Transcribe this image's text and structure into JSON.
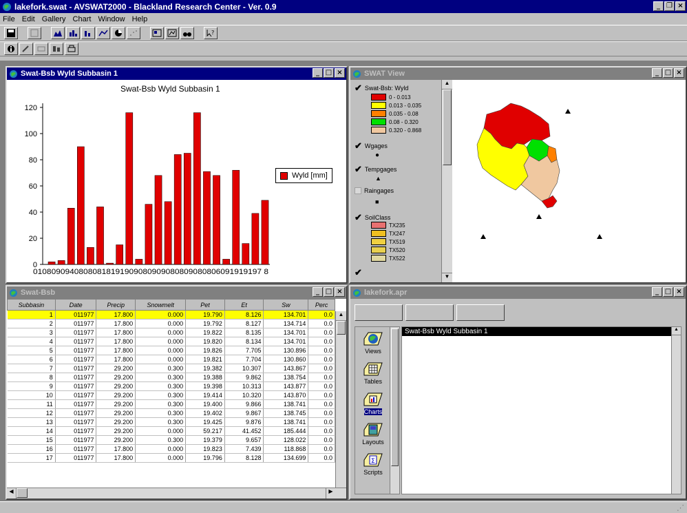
{
  "app": {
    "title": "lakefork.swat - AVSWAT2000 - Blackland Research Center - Ver. 0.9",
    "menus": [
      "File",
      "Edit",
      "Gallery",
      "Chart",
      "Window",
      "Help"
    ]
  },
  "chart_window": {
    "title": "Swat-Bsb Wyld Subbasin 1",
    "chart_data": {
      "type": "bar",
      "title": "Swat-Bsb Wyld Subbasin 1",
      "xtick_text": "01080909408080818191909080909080809080806091919197 8",
      "series": [
        {
          "name": "Wyld  [mm]",
          "color": "#e00000",
          "values": [
            2,
            3,
            43,
            90,
            13,
            44,
            1,
            15,
            116,
            4,
            46,
            68,
            48,
            84,
            85,
            116,
            71,
            68,
            4,
            72,
            16,
            39,
            49
          ]
        }
      ],
      "yticks": [
        "0",
        "20",
        "40",
        "60",
        "80",
        "100",
        "120"
      ],
      "ylim": [
        0,
        120
      ],
      "legend_position": "right",
      "grid": false
    }
  },
  "view_window": {
    "title": "SWAT View",
    "toc": {
      "theme1": "Swat-Bsb: Wyld",
      "classes": [
        {
          "label": "0 - 0.013",
          "color": "#e00000"
        },
        {
          "label": "0.013 - 0.035",
          "color": "#ffff00"
        },
        {
          "label": "0.035 - 0.08",
          "color": "#ff8000"
        },
        {
          "label": "0.08 - 0.320",
          "color": "#00e000"
        },
        {
          "label": "0.320 - 0.868",
          "color": "#f0c8a0"
        }
      ],
      "theme2": "Wgages",
      "theme3": "Tempgages",
      "theme4": "Raingages",
      "theme5": "SoilClass",
      "soil_classes": [
        {
          "label": "TX235",
          "color": "#e87070"
        },
        {
          "label": "TX247",
          "color": "#f0c020"
        },
        {
          "label": "TX519",
          "color": "#f0d040"
        },
        {
          "label": "TX520",
          "color": "#e8d050"
        },
        {
          "label": "TX522",
          "color": "#e0d8a0"
        }
      ]
    }
  },
  "table_window": {
    "title": "Swat-Bsb",
    "columns": [
      "Subbasin",
      "Date",
      "Precip",
      "Snowmelt",
      "Pet",
      "Et",
      "Sw",
      "Perc"
    ],
    "rows": [
      [
        "1",
        "011977",
        "17.800",
        "0.000",
        "19.790",
        "8.126",
        "134.701",
        "0.0"
      ],
      [
        "2",
        "011977",
        "17.800",
        "0.000",
        "19.792",
        "8.127",
        "134.714",
        "0.0"
      ],
      [
        "3",
        "011977",
        "17.800",
        "0.000",
        "19.822",
        "8.135",
        "134.701",
        "0.0"
      ],
      [
        "4",
        "011977",
        "17.800",
        "0.000",
        "19.820",
        "8.134",
        "134.701",
        "0.0"
      ],
      [
        "5",
        "011977",
        "17.800",
        "0.000",
        "19.826",
        "7.705",
        "130.896",
        "0.0"
      ],
      [
        "6",
        "011977",
        "17.800",
        "0.000",
        "19.821",
        "7.704",
        "130.860",
        "0.0"
      ],
      [
        "7",
        "011977",
        "29.200",
        "0.300",
        "19.382",
        "10.307",
        "143.867",
        "0.0"
      ],
      [
        "8",
        "011977",
        "29.200",
        "0.300",
        "19.388",
        "9.862",
        "138.754",
        "0.0"
      ],
      [
        "9",
        "011977",
        "29.200",
        "0.300",
        "19.398",
        "10.313",
        "143.877",
        "0.0"
      ],
      [
        "10",
        "011977",
        "29.200",
        "0.300",
        "19.414",
        "10.320",
        "143.870",
        "0.0"
      ],
      [
        "11",
        "011977",
        "29.200",
        "0.300",
        "19.400",
        "9.866",
        "138.741",
        "0.0"
      ],
      [
        "12",
        "011977",
        "29.200",
        "0.300",
        "19.402",
        "9.867",
        "138.745",
        "0.0"
      ],
      [
        "13",
        "011977",
        "29.200",
        "0.300",
        "19.425",
        "9.876",
        "138.741",
        "0.0"
      ],
      [
        "14",
        "011977",
        "29.200",
        "0.000",
        "59.217",
        "41.452",
        "185.444",
        "0.0"
      ],
      [
        "15",
        "011977",
        "29.200",
        "0.300",
        "19.379",
        "9.657",
        "128.022",
        "0.0"
      ],
      [
        "16",
        "011977",
        "17.800",
        "0.000",
        "19.823",
        "7.439",
        "118.868",
        "0.0"
      ],
      [
        "17",
        "011977",
        "17.800",
        "0.000",
        "19.796",
        "8.128",
        "134.699",
        "0.0"
      ]
    ]
  },
  "project_window": {
    "title": "lakefork.apr",
    "items": [
      "Views",
      "Tables",
      "Charts",
      "Layouts",
      "Scripts"
    ],
    "selected": "Charts",
    "list": [
      "Swat-Bsb Wyld Subbasin 1"
    ]
  }
}
